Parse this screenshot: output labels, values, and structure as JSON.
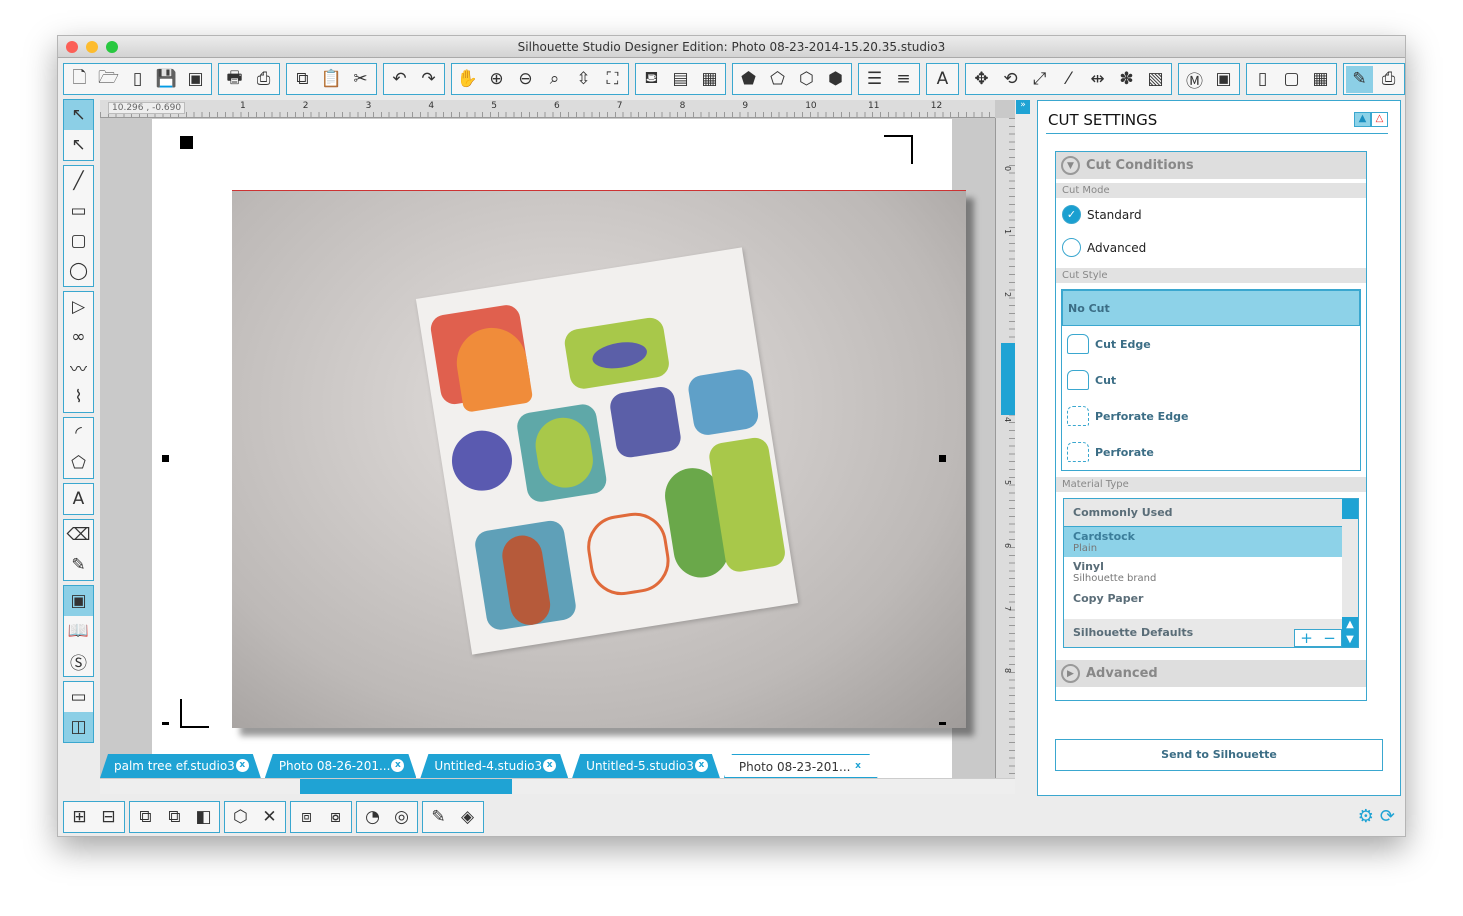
{
  "window": {
    "title": "Silhouette Studio Designer Edition: Photo 08-23-2014-15.20.35.studio3"
  },
  "toolbar": {
    "groups": [
      [
        "new-document-icon:🗋",
        "open-folder-icon:🗁",
        "open-sd-icon:▯",
        "save-icon:💾",
        "save-sd-icon:▣"
      ],
      [
        "print-icon:🖶",
        "print-cut-icon:⎙"
      ],
      [
        "copy-icon:⧉",
        "paste-icon:📋",
        "cut-scissors-icon:✂"
      ],
      [
        "undo-icon:↶",
        "redo-icon:↷"
      ],
      [
        "pan-hand-icon:✋",
        "zoom-in-icon:⊕",
        "zoom-out-icon:⊖",
        "zoom-select-icon:⌕",
        "drag-zoom-icon:⇳",
        "fit-page-icon:⛶"
      ],
      [
        "fill-color-icon:⛾",
        "fill-gradient-icon:▤",
        "fill-pattern-icon:▦"
      ],
      [
        "line-color-icon:⬟",
        "line-style-icon:⬠",
        "point-edit-icon:⬡",
        "transform-icon:⬢"
      ],
      [
        "align-icon:☰",
        "offset-icon:≡"
      ],
      [
        "text-style-icon:A"
      ],
      [
        "replicate-icon:✥",
        "rotate-icon:⟲",
        "scale-icon:⤢",
        "modify-icon:⁄",
        "move-icon:⇹",
        "trace-icon:✽",
        "knife-icon:▧"
      ],
      [
        "library-icon:Ⓜ",
        "design-store-icon:▣"
      ],
      [
        "page-settings-icon:▯",
        "registration-icon:▢",
        "grid-icon:▦"
      ],
      [
        "cut-settings-icon:✎",
        "send-icon:⎙"
      ]
    ],
    "selected": "cut-settings-icon"
  },
  "left_tools": {
    "groups": [
      [
        "select-arrow-icon:↖",
        "point-edit-arrow-icon:↖"
      ],
      [
        "line-tool-icon:╱",
        "rectangle-tool-icon:▭",
        "rounded-rect-tool-icon:▢",
        "ellipse-tool-icon:◯"
      ],
      [
        "polygon-tool-icon:▷",
        "curve-tool-icon:∞",
        "freehand-tool-icon:〰",
        "smooth-freehand-icon:⌇"
      ],
      [
        "arc-tool-icon:◜",
        "regular-polygon-icon:⬠"
      ],
      [
        "text-tool-icon:A"
      ],
      [
        "eraser-tool-icon:⌫",
        "knife-tool-icon:✎"
      ],
      [
        "show-design-area-icon:▣",
        "library-view-icon:📖",
        "store-icon:Ⓢ"
      ],
      [
        "cut-view-icon:▭",
        "split-view-icon:◫"
      ]
    ],
    "selected": [
      "select-arrow-icon",
      "show-design-area-icon",
      "split-view-icon"
    ]
  },
  "ruler": {
    "coordinates": "10.296 , -0.690",
    "ticks": [
      "1",
      "2",
      "3",
      "4",
      "5",
      "6",
      "7",
      "8",
      "9",
      "10",
      "11",
      "12"
    ],
    "vticks": [
      "0",
      "1",
      "2",
      "3",
      "4",
      "5",
      "6",
      "7",
      "8"
    ]
  },
  "tabs": [
    {
      "label": "palm tree ef.studio3",
      "close": "x",
      "active": false
    },
    {
      "label": "Photo 08-26-201...",
      "close": "x",
      "active": false
    },
    {
      "label": "Untitled-4.studio3",
      "close": "x",
      "active": false
    },
    {
      "label": "Untitled-5.studio3",
      "close": "x",
      "active": false
    },
    {
      "label": "Photo 08-23-201...",
      "close": "x",
      "active": true
    }
  ],
  "cut_settings": {
    "title": "CUT SETTINGS",
    "cut_conditions": "Cut Conditions",
    "cut_mode_label": "Cut Mode",
    "modes": [
      {
        "label": "Standard",
        "checked": true
      },
      {
        "label": "Advanced",
        "checked": false
      }
    ],
    "cut_style_label": "Cut Style",
    "styles": [
      {
        "label": "No Cut",
        "selected": true
      },
      {
        "label": "Cut Edge"
      },
      {
        "label": "Cut"
      },
      {
        "label": "Perforate Edge"
      },
      {
        "label": "Perforate"
      }
    ],
    "material_type_label": "Material Type",
    "materials": {
      "header": "Commonly Used",
      "items": [
        {
          "name": "Cardstock",
          "sub": "Plain",
          "selected": true
        },
        {
          "name": "Vinyl",
          "sub": "Silhouette brand"
        },
        {
          "name": "Copy Paper",
          "sub": ""
        }
      ],
      "footer": "Silhouette Defaults",
      "add": "+",
      "remove": "−"
    },
    "advanced": "Advanced",
    "send_button": "Send to Silhouette"
  },
  "bottom_toolbar": [
    [
      "group-icon:⊞",
      "ungroup-icon:⊟"
    ],
    [
      "bring-front-icon:⧉",
      "send-back-icon:⧉",
      "bring-forward-icon:◧"
    ],
    [
      "make-compound-icon:⬡",
      "release-compound-icon:✕"
    ],
    [
      "weld-icon:⧈",
      "subtract-icon:⧇"
    ],
    [
      "offset-tool-icon:◔",
      "trace-tool-icon:◎"
    ],
    [
      "knife-bottom-icon:✎",
      "cut-settings-bottom-icon:◈"
    ]
  ],
  "colors": {
    "accent": "#1fa3d4",
    "selection": "#8dd2e8"
  }
}
